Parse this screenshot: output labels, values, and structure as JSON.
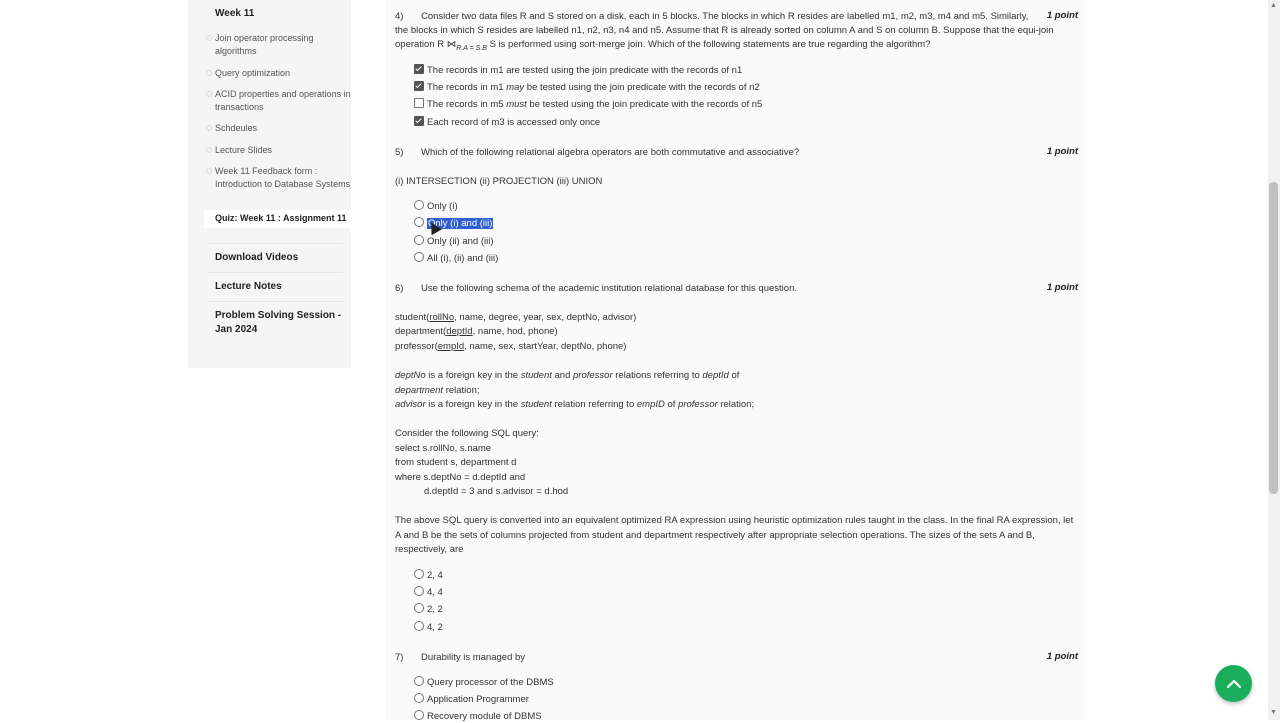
{
  "sidebar": {
    "week_heading": "Week 11",
    "sub_items": [
      {
        "label": "Join operator processing algorithms"
      },
      {
        "label": "Query optimization"
      },
      {
        "label": "ACID properties and operations in transactions"
      },
      {
        "label": "Schdeules"
      },
      {
        "label": "Lecture Slides"
      },
      {
        "label": "Week 11 Feedback form : Introduction to Database Systems"
      },
      {
        "label": "Quiz: Week 11 : Assignment 11"
      }
    ],
    "sections": [
      {
        "label": "Download Videos"
      },
      {
        "label": "Lecture Notes"
      },
      {
        "label": "Problem Solving Session - Jan 2024"
      }
    ]
  },
  "questions": {
    "q4": {
      "number": "4)",
      "points": "1 point",
      "text_1": "Consider two data files R and S stored on a disk, each in 5 blocks. The blocks in which R resides are labelled m1, m2, m3, m4 and m5. Similarly,",
      "text_2": "the blocks in which S resides are labelled n1, n2, n3, n4 and n5. Assume that R is already sorted on column A and S on column B. Suppose that the equi-join",
      "text_3_pre": "operation R",
      "join_symbol": "⋈",
      "join_cond": "R.A = S.B",
      "text_3_post": "S is performed using sort-merge join. Which of the following statements are true regarding the algorithm?",
      "options": [
        {
          "checked": true,
          "pre": "The records in m1 are tested using the join predicate with the records of n1",
          "em": "",
          "post": ""
        },
        {
          "checked": true,
          "pre": "The records in m1 ",
          "em": "may",
          "post": " be tested using the join predicate with the records of n2"
        },
        {
          "checked": false,
          "pre": "The records in m5 ",
          "em": "must",
          "post": " be tested using the join predicate with the records of n5"
        },
        {
          "checked": true,
          "pre": "Each record of m3 is accessed only once",
          "em": "",
          "post": ""
        }
      ]
    },
    "q5": {
      "number": "5)",
      "points": "1 point",
      "text": "Which of the following relational algebra operators are both commutative and associative?",
      "subtext": "(i) INTERSECTION (ii) PROJECTION (iii) UNION",
      "options": [
        "Only (i)",
        "Only (i) and (iii)",
        "Only (ii) and (iii)",
        "All (i), (ii) and (iii)"
      ]
    },
    "q6": {
      "number": "6)",
      "points": "1 point",
      "text": "Use the following schema of the academic institution relational database for this question.",
      "schema": {
        "student_name": "student(",
        "student_key": "rollNo",
        "student_rest": ", name, degree, year, sex, deptNo, advisor)",
        "department_name": "department(",
        "department_key": "deptId",
        "department_rest": ", name, hod, phone)",
        "professor_name": "professor(",
        "professor_key": "empId",
        "professor_rest": ", name, sex, startYear, deptNo, phone)"
      },
      "fk": {
        "l1_a": "deptNo",
        "l1_b": " is a foreign key in the ",
        "l1_c": "student",
        "l1_d": " and ",
        "l1_e": "professor",
        "l1_f": " relations referring to ",
        "l1_g": "deptId",
        "l1_h": " of",
        "l2_a": "department",
        "l2_b": " relation;",
        "l3_a": "advisor",
        "l3_b": " is a foreign key in the ",
        "l3_c": "student",
        "l3_d": " relation referring to ",
        "l3_e": "empID",
        "l3_f": " of ",
        "l3_g": "professor",
        "l3_h": " relation;"
      },
      "sql": {
        "intro": "Consider the following SQL query:",
        "l1": "select s.rollNo, s.name",
        "l2": "from student s, department d",
        "l3": "where s.deptNo = d.deptId and",
        "l4": "d.deptId = 3 and s.advisor = d.hod"
      },
      "para": "The above SQL query is converted into an equivalent optimized RA expression using heuristic optimization rules taught in the class. In the final RA expression, let A and B be the sets of columns projected from student and department respectively after appropriate selection operations. The sizes of the sets A and B, respectively, are",
      "options": [
        "2, 4",
        "4, 4",
        "2, 2",
        "4, 2"
      ]
    },
    "q7": {
      "number": "7)",
      "points": "1 point",
      "text": "Durability is managed by",
      "options": [
        "Query processor of the DBMS",
        "Application Programmer",
        "Recovery module of DBMS"
      ]
    }
  },
  "icons": {
    "fab": "chevron-up-icon",
    "fab_color": "#1aae5c",
    "highlight_color": "#2f5fd0"
  }
}
